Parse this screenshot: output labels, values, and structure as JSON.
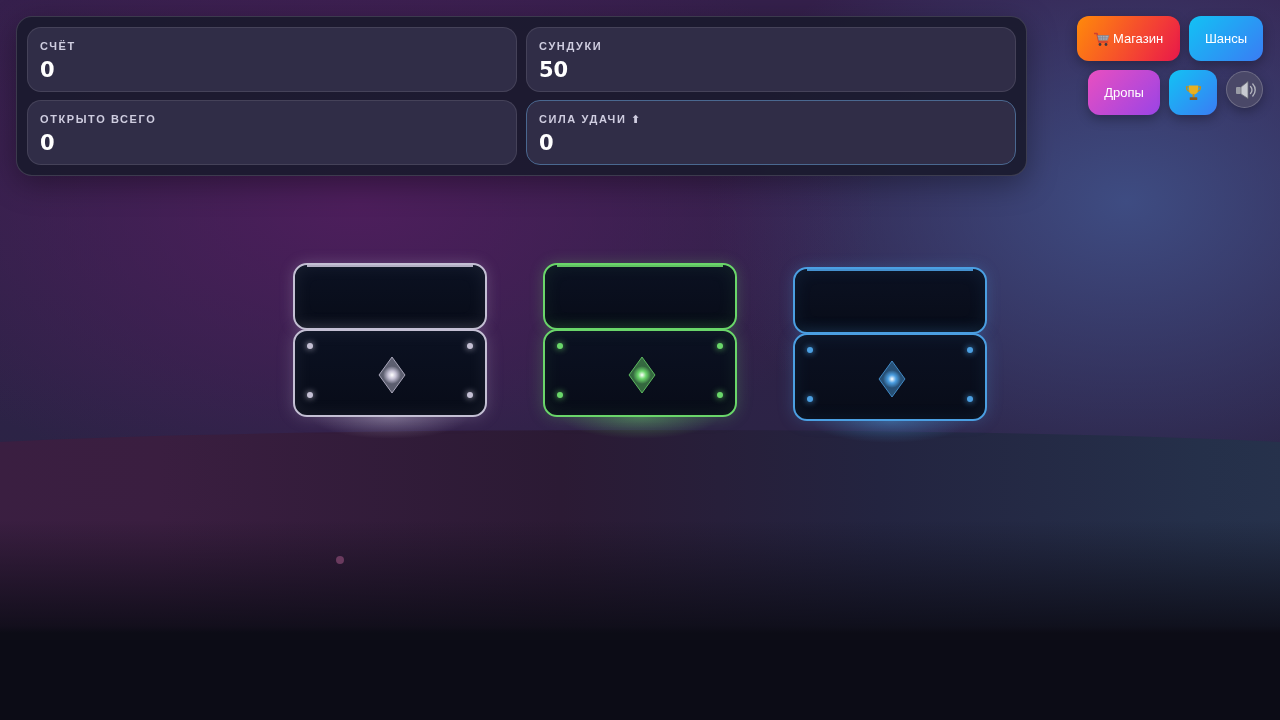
{
  "stats": [
    {
      "label": "СЧЁТ",
      "value": "0",
      "highlighted": false
    },
    {
      "label": "СУНДУКИ",
      "value": "50",
      "highlighted": false
    },
    {
      "label": "ОТКРЫТО ВСЕГО",
      "value": "0",
      "highlighted": false
    },
    {
      "label": "СИЛА УДАЧИ ⬆",
      "value": "0",
      "highlighted": true
    }
  ],
  "buttons": [
    {
      "kind": "shop",
      "label": "Магазин"
    },
    {
      "kind": "chances",
      "label": "Шансы"
    },
    {
      "kind": "drops",
      "label": "Дропы"
    },
    {
      "kind": "trophy"
    },
    {
      "kind": "sound"
    }
  ],
  "chests": [
    {
      "color": "#c4c0d4"
    },
    {
      "color": "#6ad66a"
    },
    {
      "color": "#4b9fe2"
    }
  ]
}
